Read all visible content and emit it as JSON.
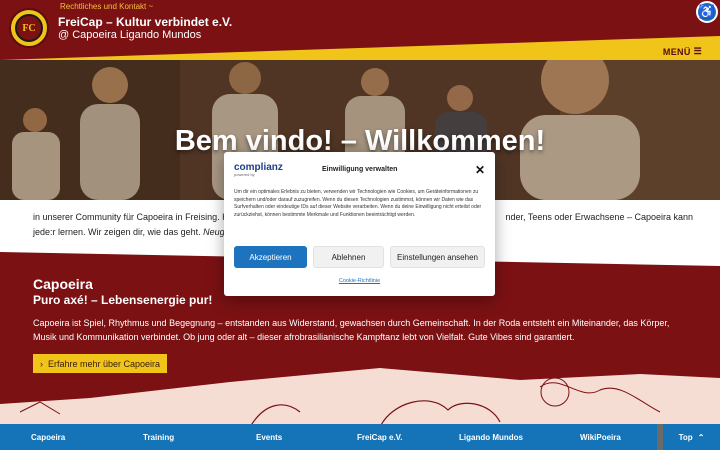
{
  "colors": {
    "primary": "#7b1113",
    "accent": "#f0c418",
    "nav": "#1474b7",
    "button": "#1e73be"
  },
  "header": {
    "toplink": "Rechtliches und Kontakt ~",
    "brand_line1": "FreiCap – Kultur verbindet e.V.",
    "brand_line2": "@ Capoeira Ligando Mundos",
    "menu_label": "MENÜ",
    "menu_icon": "hamburger-icon",
    "logo_text": "FC",
    "accessibility_icon": "accessibility-icon"
  },
  "hero": {
    "title": "Bem vindo! – Willkommen!"
  },
  "intro": {
    "line1_start": "in unserer Community für Capoeira in Freising. H",
    "line1_end": "nder, Teens oder Erwachsene – Capoeira kann",
    "line2": "jede:r lernen. Wir zeigen dir, wie das geht.",
    "line2_em": "Neugi"
  },
  "capoeira": {
    "heading": "Capoeira",
    "subheading": "Puro axé! – Lebensenergie pur!",
    "text": "Capoeira ist Spiel, Rhythmus und Begegnung – entstanden aus Widerstand, gewachsen durch Gemeinschaft. In der Roda entsteht ein Miteinander, das Körper, Musik und Kommunikation verbindet. Ob jung oder alt – dieser afrobrasilianische Kampftanz lebt von Vielfalt. Gute Vibes sind garantiert.",
    "button_label": "Erfahre mehr über Capoeira",
    "button_icon": "chevron-right-icon"
  },
  "bottom_nav": {
    "items": [
      "Capoeira",
      "Training",
      "Events",
      "FreiCap e.V.",
      "Ligando Mundos",
      "WikiPoeira"
    ],
    "top_label": "Top",
    "top_icon": "chevron-up-icon"
  },
  "consent": {
    "logo": "complianz",
    "powered": "powered by",
    "title": "Einwilligung verwalten",
    "close_icon": "close-icon",
    "text": "Um dir ein optimales Erlebnis zu bieten, verwenden wir Technologien wie Cookies, um Geräteinformationen zu speichern und/oder darauf zuzugreifen. Wenn du diesen Technologien zustimmst, können wir Daten wie das Surfverhalten oder eindeutige IDs auf dieser Website verarbeiten. Wenn du deine Einwilligung nicht erteilst oder zurückziehst, können bestimmte Merkmale und Funktionen beeinträchtigt werden.",
    "accept_label": "Akzeptieren",
    "deny_label": "Ablehnen",
    "settings_label": "Einstellungen ansehen",
    "policy_link": "Cookie-Richtlinie"
  }
}
